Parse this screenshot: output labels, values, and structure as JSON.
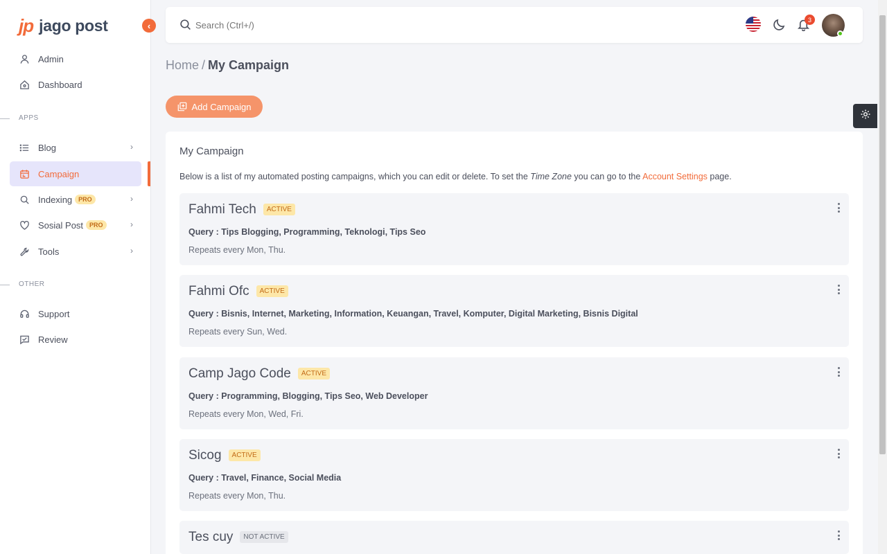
{
  "app": {
    "logo_mark": "jp",
    "logo_text": "jago post"
  },
  "sidebar": {
    "items": [
      {
        "label": "Admin",
        "icon": "user-icon"
      },
      {
        "label": "Dashboard",
        "icon": "home-icon"
      }
    ],
    "section_apps": "APPS",
    "apps": [
      {
        "label": "Blog",
        "icon": "list-icon",
        "has_children": true
      },
      {
        "label": "Campaign",
        "icon": "calendar-icon",
        "active": true
      },
      {
        "label": "Indexing",
        "icon": "search-icon",
        "badge": "PRO",
        "has_children": true
      },
      {
        "label": "Sosial Post",
        "icon": "heart-icon",
        "badge": "PRO",
        "has_children": true
      },
      {
        "label": "Tools",
        "icon": "tools-icon",
        "has_children": true
      }
    ],
    "section_other": "OTHER",
    "other": [
      {
        "label": "Support",
        "icon": "headset-icon"
      },
      {
        "label": "Review",
        "icon": "chat-icon"
      }
    ]
  },
  "topbar": {
    "search_placeholder": "Search (Ctrl+/)",
    "notification_count": "3"
  },
  "breadcrumb": {
    "home": "Home",
    "separator": "/",
    "current": "My Campaign"
  },
  "actions": {
    "add_campaign": "Add Campaign"
  },
  "card": {
    "title": "My Campaign",
    "desc_before": "Below is a list of my automated posting campaigns, which you can edit or delete. To set the ",
    "desc_em": "Time Zone",
    "desc_mid": " you can go to the ",
    "desc_link": "Account Settings",
    "desc_after": " page."
  },
  "campaigns": [
    {
      "name": "Fahmi Tech",
      "status": "ACTIVE",
      "query_label": "Query : ",
      "query": "Tips Blogging, Programming, Teknologi, Tips Seo",
      "repeat": "Repeats every Mon, Thu."
    },
    {
      "name": "Fahmi Ofc",
      "status": "ACTIVE",
      "query_label": "Query : ",
      "query": "Bisnis, Internet, Marketing, Information, Keuangan, Travel, Komputer, Digital Marketing, Bisnis Digital",
      "repeat": "Repeats every Sun, Wed."
    },
    {
      "name": "Camp Jago Code",
      "status": "ACTIVE",
      "query_label": "Query : ",
      "query": "Programming, Blogging, Tips Seo, Web Developer",
      "repeat": "Repeats every Mon, Wed, Fri."
    },
    {
      "name": "Sicog",
      "status": "ACTIVE",
      "query_label": "Query : ",
      "query": "Travel, Finance, Social Media",
      "repeat": "Repeats every Mon, Thu."
    },
    {
      "name": "Tes cuy",
      "status": "NOT ACTIVE",
      "query_label": "",
      "query": "",
      "repeat": ""
    }
  ],
  "colors": {
    "accent": "#f26b3a",
    "active_badge_bg": "#fde7a8",
    "active_badge_text": "#c26b17",
    "inactive_badge_bg": "#e6e7eb"
  }
}
